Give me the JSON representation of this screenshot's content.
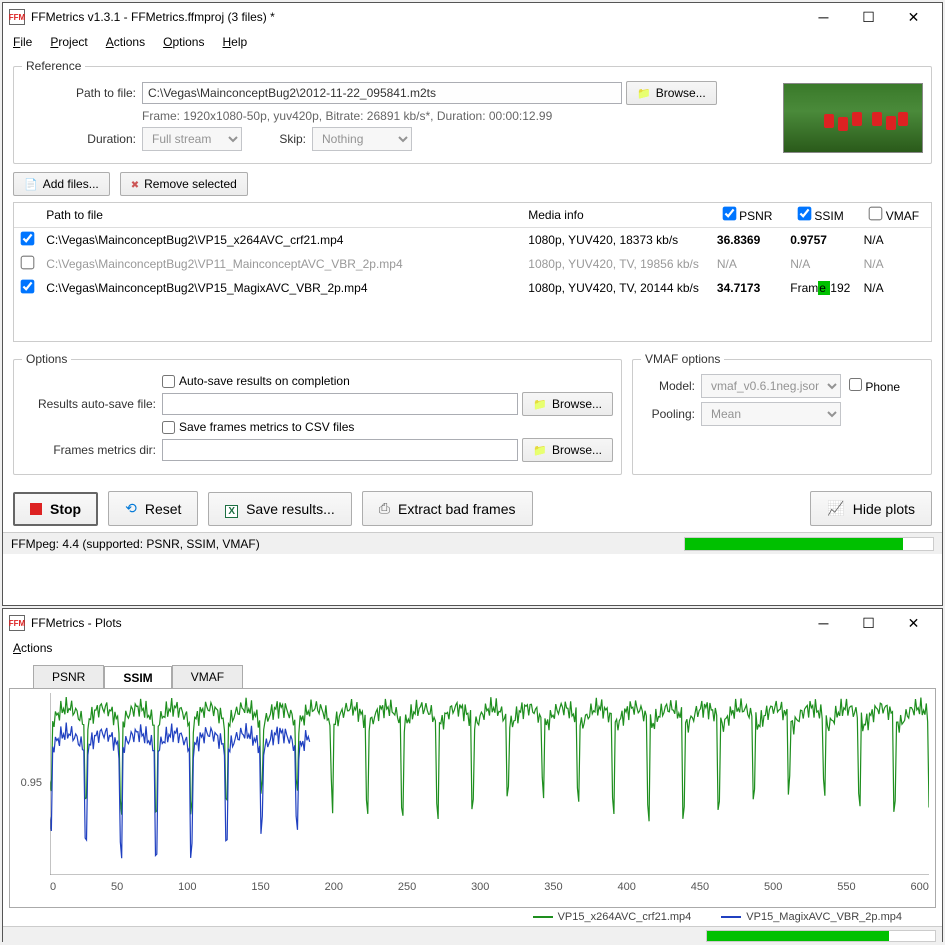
{
  "main_window": {
    "title": "FFMetrics v1.3.1 - FFMetrics.ffmproj (3 files) *",
    "menu": {
      "file": "File",
      "project": "Project",
      "actions": "Actions",
      "options": "Options",
      "help": "Help"
    },
    "reference": {
      "legend": "Reference",
      "path_label": "Path to file:",
      "path_value": "C:\\Vegas\\MainconceptBug2\\2012-11-22_095841.m2ts",
      "browse": "Browse...",
      "frame_info": "Frame: 1920x1080-50p, yuv420p, Bitrate: 26891 kb/s*, Duration: 00:00:12.99",
      "duration_label": "Duration:",
      "duration_value": "Full stream",
      "skip_label": "Skip:",
      "skip_value": "Nothing"
    },
    "toolbar": {
      "add_files": "Add files...",
      "remove_selected": "Remove selected"
    },
    "filelist": {
      "headers": {
        "path": "Path to file",
        "media": "Media info",
        "psnr": "PSNR",
        "ssim": "SSIM",
        "vmaf": "VMAF"
      },
      "rows": [
        {
          "checked": true,
          "enabled": true,
          "path": "C:\\Vegas\\MainconceptBug2\\VP15_x264AVC_crf21.mp4",
          "media": "1080p, YUV420, 18373 kb/s",
          "psnr": "36.8369",
          "ssim": "0.9757",
          "vmaf": "N/A",
          "psnr_bold": true,
          "ssim_bold": true
        },
        {
          "checked": false,
          "enabled": false,
          "path": "C:\\Vegas\\MainconceptBug2\\VP11_MainconceptAVC_VBR_2p.mp4",
          "media": "1080p, YUV420, TV, 19856 kb/s",
          "psnr": "N/A",
          "ssim": "N/A",
          "vmaf": "N/A",
          "psnr_bold": false,
          "ssim_bold": false
        },
        {
          "checked": true,
          "enabled": true,
          "path": "C:\\Vegas\\MainconceptBug2\\VP15_MagixAVC_VBR_2p.mp4",
          "media": "1080p, YUV420, TV, 20144 kb/s",
          "psnr": "34.7173",
          "ssim_prefix": "Fram",
          "ssim_highlight": "e ",
          "ssim_suffix": "192",
          "vmaf": "N/A",
          "psnr_bold": true,
          "ssim_bold": false,
          "ssim_progress": true
        }
      ]
    },
    "options": {
      "legend": "Options",
      "autosave_label": "Auto-save results on completion",
      "results_label": "Results auto-save file:",
      "browse": "Browse...",
      "csv_label": "Save frames metrics to CSV files",
      "frames_dir_label": "Frames metrics dir:"
    },
    "vmaf": {
      "legend": "VMAF options",
      "model_label": "Model:",
      "model_value": "vmaf_v0.6.1neg.json",
      "phone_label": "Phone",
      "pooling_label": "Pooling:",
      "pooling_value": "Mean"
    },
    "buttons": {
      "stop": "Stop",
      "reset": "Reset",
      "save_results": "Save results...",
      "extract": "Extract bad frames",
      "hide_plots": "Hide plots"
    },
    "status": {
      "text": "FFMpeg: 4.4 (supported: PSNR, SSIM, VMAF)",
      "progress_pct": 88
    }
  },
  "plots_window": {
    "title": "FFMetrics - Plots",
    "menu": {
      "actions": "Actions"
    },
    "tabs": {
      "psnr": "PSNR",
      "ssim": "SSIM",
      "vmaf": "VMAF",
      "active": "SSIM"
    },
    "legend": {
      "series1": "VP15_x264AVC_crf21.mp4",
      "series2": "VP15_MagixAVC_VBR_2p.mp4"
    },
    "status": {
      "progress_pct": 80
    }
  },
  "chart_data": {
    "type": "line",
    "title": "SSIM",
    "xlabel": "",
    "ylabel": "",
    "xlim": [
      0,
      650
    ],
    "ylim": [
      0.9,
      1.0
    ],
    "xticks": [
      0,
      50,
      100,
      150,
      200,
      250,
      300,
      350,
      400,
      450,
      500,
      550,
      600
    ],
    "yticks": [
      0.95
    ],
    "series": [
      {
        "name": "VP15_x264AVC_crf21.mp4",
        "color": "#1e8e1e",
        "x_range": [
          0,
          650
        ],
        "note": "Full-length series across all ~650 frames, mostly between 0.97 and 0.995 with periodic dips to ~0.92-0.94 roughly every 20-30 frames"
      },
      {
        "name": "VP15_MagixAVC_VBR_2p.mp4",
        "color": "#2040c0",
        "x_range": [
          0,
          192
        ],
        "note": "Partial series (frames 0-192 processed so far), mostly 0.96-0.98 with sharp dips below 0.92 near frames ~30, ~55, ~75, ~105, ~150, ~175"
      }
    ]
  }
}
